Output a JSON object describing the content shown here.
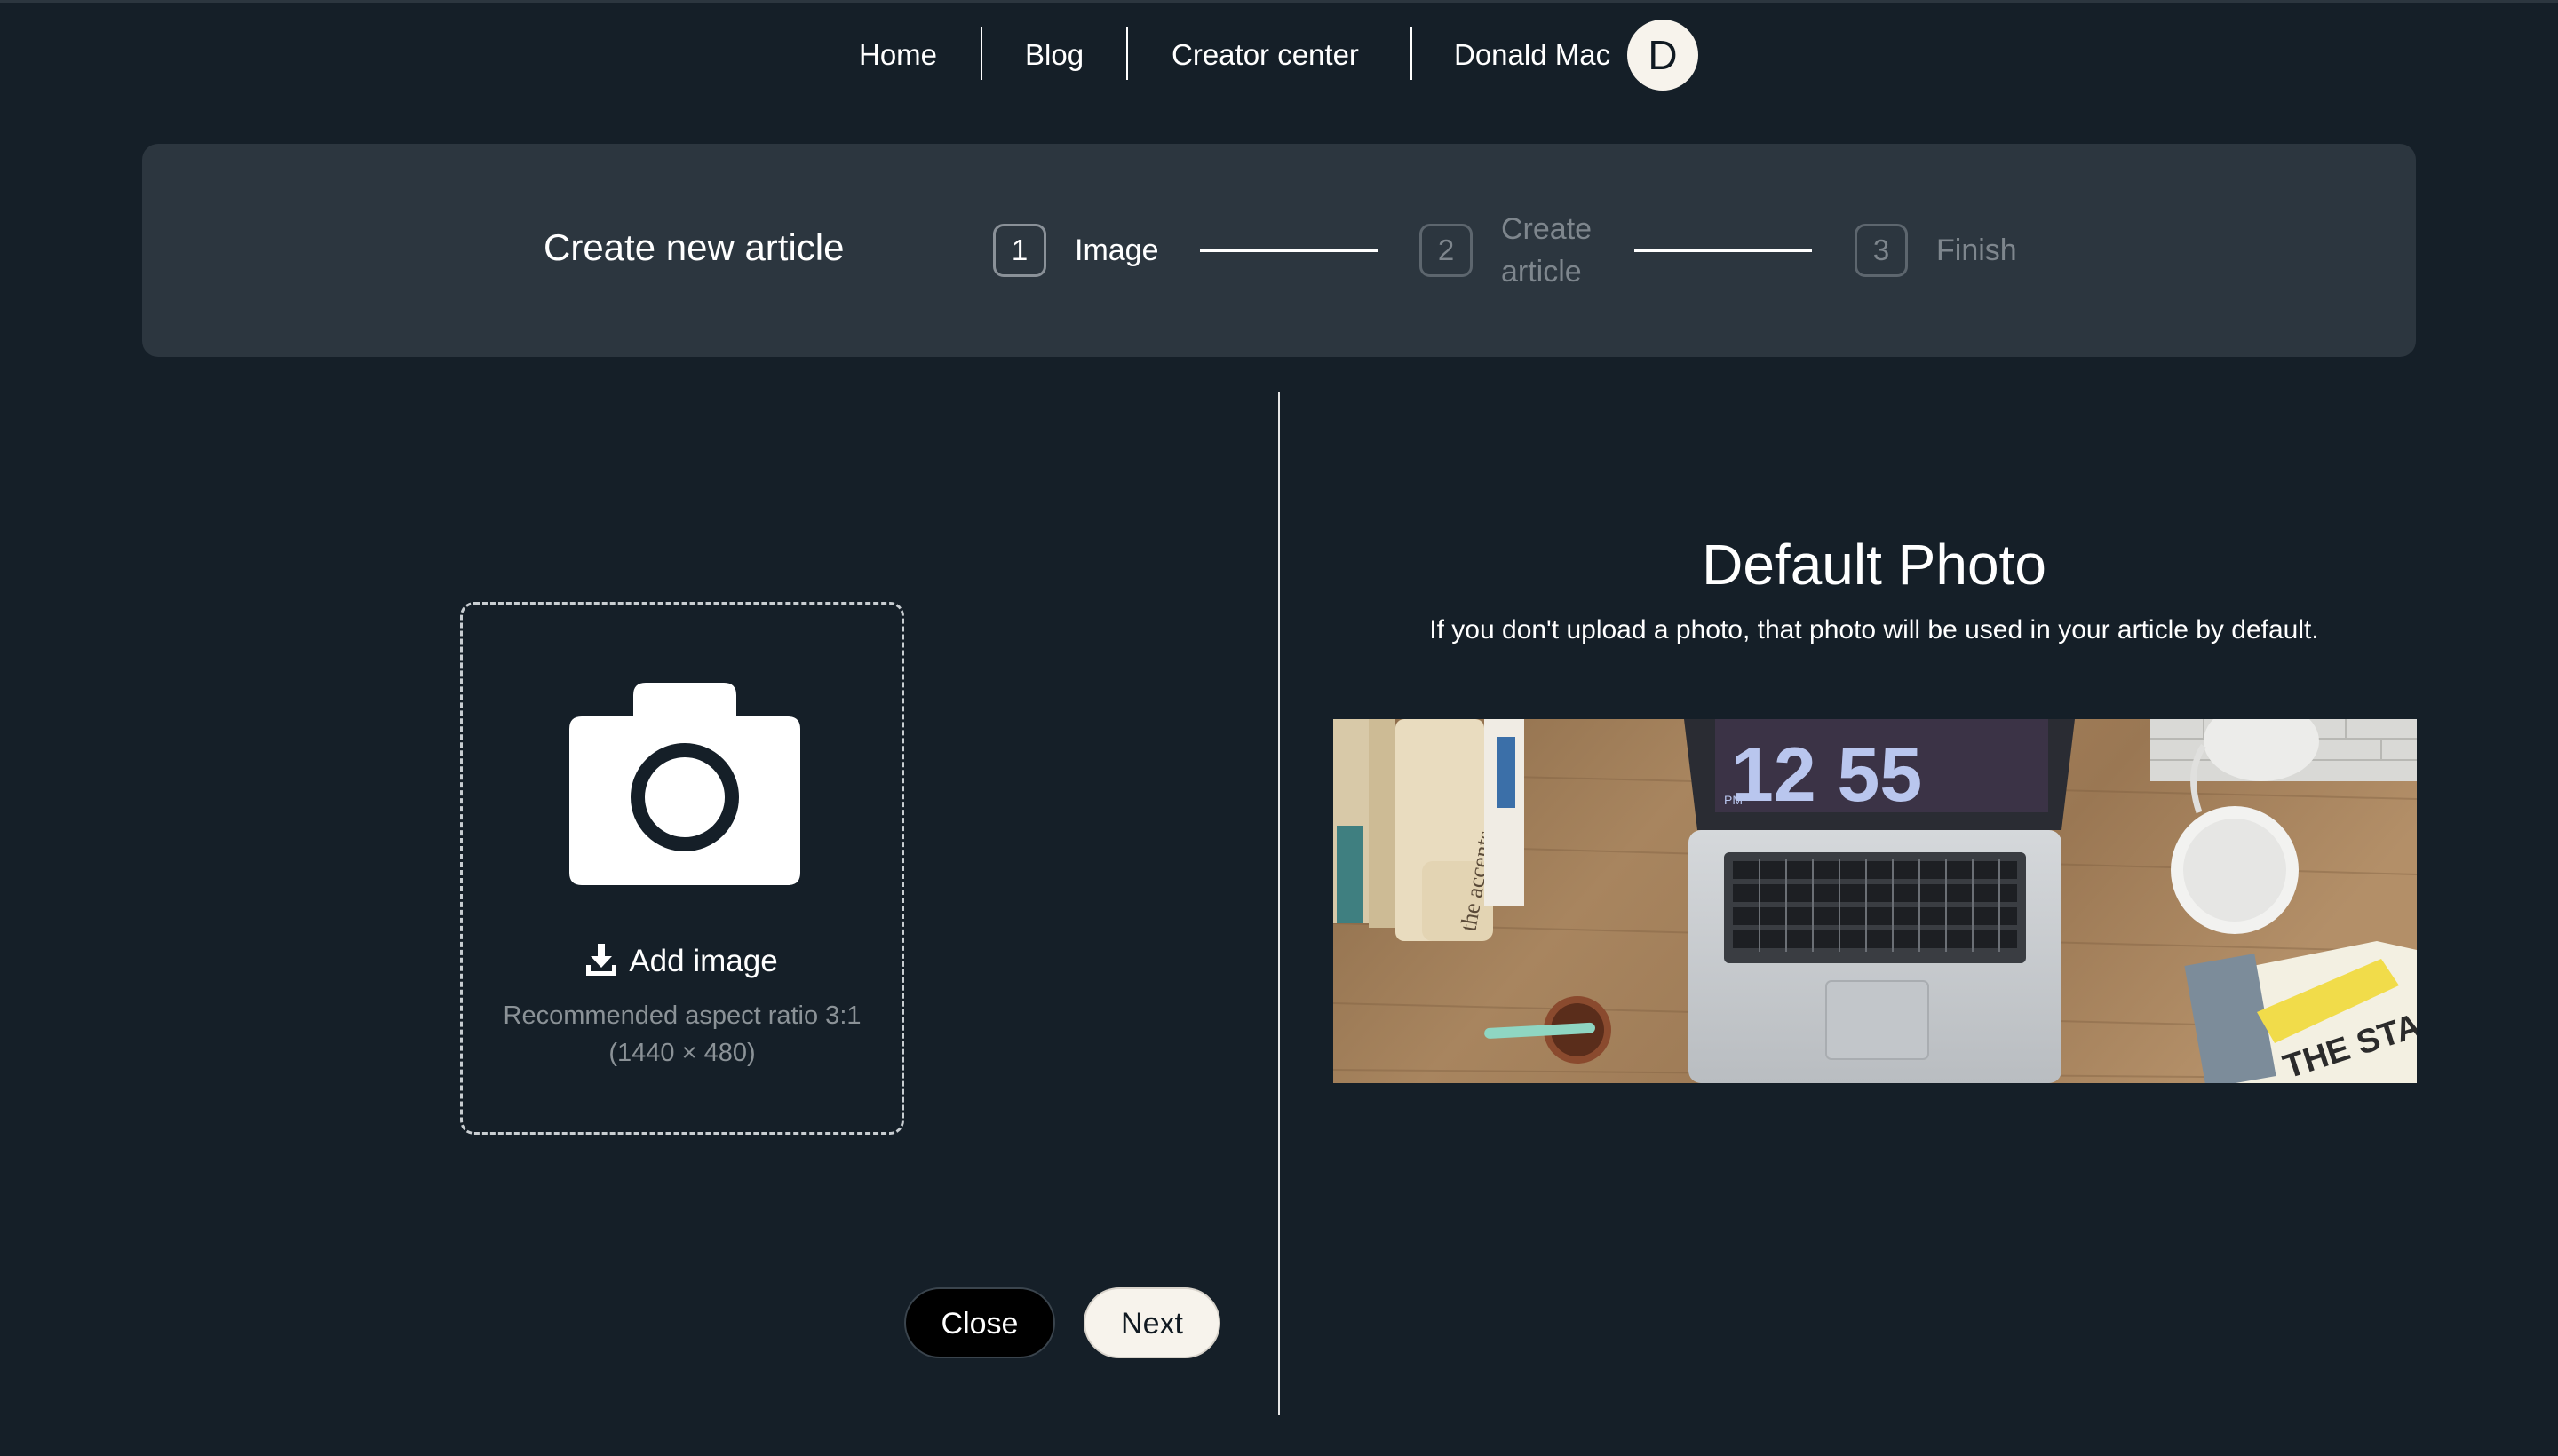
{
  "nav": {
    "home": "Home",
    "blog": "Blog",
    "creator_center": "Creator center",
    "user_name": "Donald Mac",
    "avatar_initial": "D"
  },
  "stepper": {
    "title": "Create new article",
    "steps": [
      {
        "number": "1",
        "label": "Image",
        "state": "active"
      },
      {
        "number": "2",
        "label_line1": "Create",
        "label_line2": "article",
        "state": "inactive"
      },
      {
        "number": "3",
        "label": "Finish",
        "state": "inactive"
      }
    ]
  },
  "upload": {
    "icon": "camera-icon",
    "add_icon": "download-icon",
    "add_label": "Add image",
    "recommend_line1": "Recommended aspect ratio 3:1",
    "recommend_line2": "(1440 × 480)"
  },
  "buttons": {
    "close": "Close",
    "next": "Next"
  },
  "default_photo": {
    "title": "Default Photo",
    "description": "If you don't upload a photo, that photo will be used in your article by default.",
    "screen_time": "12 55",
    "screen_ampm": "PM",
    "book_spine_text": "the accents",
    "magazine_text": "THE STARTUP"
  },
  "colors": {
    "background": "#151f28",
    "banner": "#2c363f",
    "cream": "#f7f3ec",
    "muted_text": "#7e868d"
  }
}
